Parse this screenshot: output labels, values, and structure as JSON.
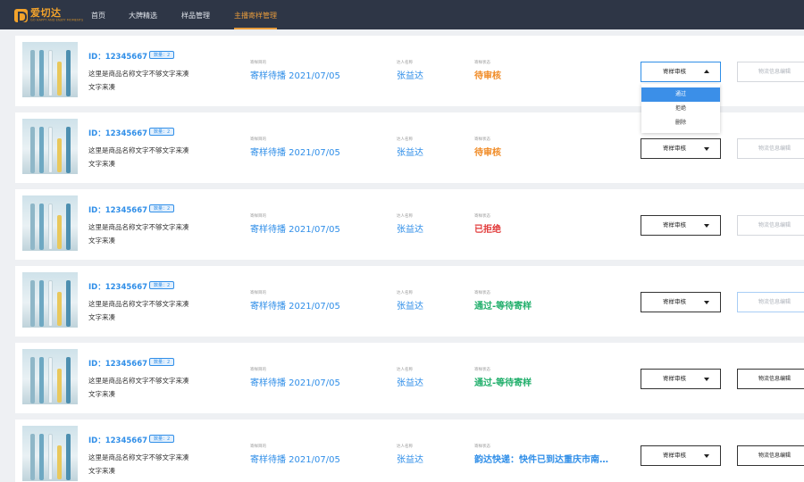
{
  "brand": {
    "name": "爱切达",
    "tagline": "GO HAPPY AND ENJOY MOMENTS"
  },
  "nav": [
    {
      "label": "首页",
      "active": false
    },
    {
      "label": "大牌精选",
      "active": false
    },
    {
      "label": "样品管理",
      "active": false
    },
    {
      "label": "主播寄样管理",
      "active": true
    }
  ],
  "labels": {
    "purpose": "寄样目的",
    "influencer": "达人名称",
    "status": "寄样状态",
    "review_button": "寄样审核",
    "logistics_button": "物流信息编辑"
  },
  "rows": [
    {
      "id_text": "ID：12345667",
      "badge": "数量：2",
      "desc": "这里是商品名称文字不够文字来凑文字来凑",
      "purpose": "寄样待播 2021/07/05",
      "influencer": "张益达",
      "status": "待审核",
      "status_color": "#f08a24"
    },
    {
      "id_text": "ID：12345667",
      "badge": "数量：2",
      "desc": "这里是商品名称文字不够文字来凑文字来凑",
      "purpose": "寄样待播 2021/07/05",
      "influencer": "张益达",
      "status": "待审核",
      "status_color": "#f08a24"
    },
    {
      "id_text": "ID：12345667",
      "badge": "数量：2",
      "desc": "这里是商品名称文字不够文字来凑文字来凑",
      "purpose": "寄样待播 2021/07/05",
      "influencer": "张益达",
      "status": "已拒绝",
      "status_color": "#e23b3b"
    },
    {
      "id_text": "ID：12345667",
      "badge": "数量：2",
      "desc": "这里是商品名称文字不够文字来凑文字来凑",
      "purpose": "寄样待播 2021/07/05",
      "influencer": "张益达",
      "status": "通过-等待寄样",
      "status_color": "#1fae6a"
    },
    {
      "id_text": "ID：12345667",
      "badge": "数量：2",
      "desc": "这里是商品名称文字不够文字来凑文字来凑",
      "purpose": "寄样待播 2021/07/05",
      "influencer": "张益达",
      "status": "通过-等待寄样",
      "status_color": "#1fae6a"
    },
    {
      "id_text": "ID：12345667",
      "badge": "数量：2",
      "desc": "这里是商品名称文字不够文字来凑文字来凑",
      "purpose": "寄样待播 2021/07/05",
      "influencer": "张益达",
      "status": "韵达快递：快件已到达重庆市南…",
      "status_color": "#2f8ee8"
    }
  ],
  "dropdown": [
    {
      "label": "通过",
      "active": true
    },
    {
      "label": "拒绝",
      "active": false
    },
    {
      "label": "删除",
      "active": false
    }
  ],
  "colors": {
    "nav_bg": "#2e3646",
    "accent_orange": "#e69b3c",
    "link_blue": "#2f8ee8"
  }
}
